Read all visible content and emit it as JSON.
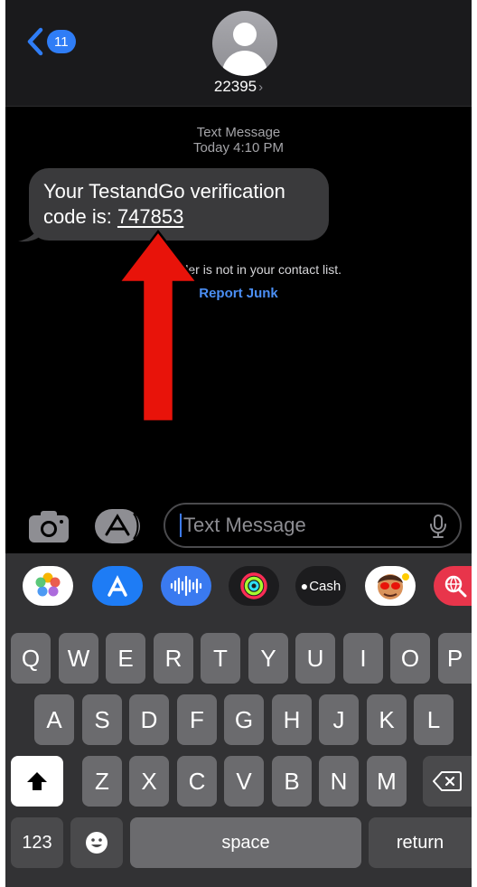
{
  "header": {
    "back_count": "11",
    "contact": "22395",
    "chevron": "›"
  },
  "conversation": {
    "service": "Text Message",
    "timestamp": "Today 4:10 PM",
    "message_prefix": "Your TestandGo verification",
    "message_line2": "code is: ",
    "code": "747853",
    "notice": "The sender is not in your contact list.",
    "report_junk": "Report Junk"
  },
  "input": {
    "placeholder": "Text Message"
  },
  "app_strip": {
    "apple_cash_label": "Cash"
  },
  "keyboard": {
    "row1": [
      "Q",
      "W",
      "E",
      "R",
      "T",
      "Y",
      "U",
      "I",
      "O",
      "P"
    ],
    "row2": [
      "A",
      "S",
      "D",
      "F",
      "G",
      "H",
      "J",
      "K",
      "L"
    ],
    "row3": [
      "Z",
      "X",
      "C",
      "V",
      "B",
      "N",
      "M"
    ],
    "numbers": "123",
    "space": "space",
    "return": "return"
  },
  "colors": {
    "accent": "#2f7df6",
    "bubble": "#3a3a3c",
    "arrow": "#e8130a"
  }
}
